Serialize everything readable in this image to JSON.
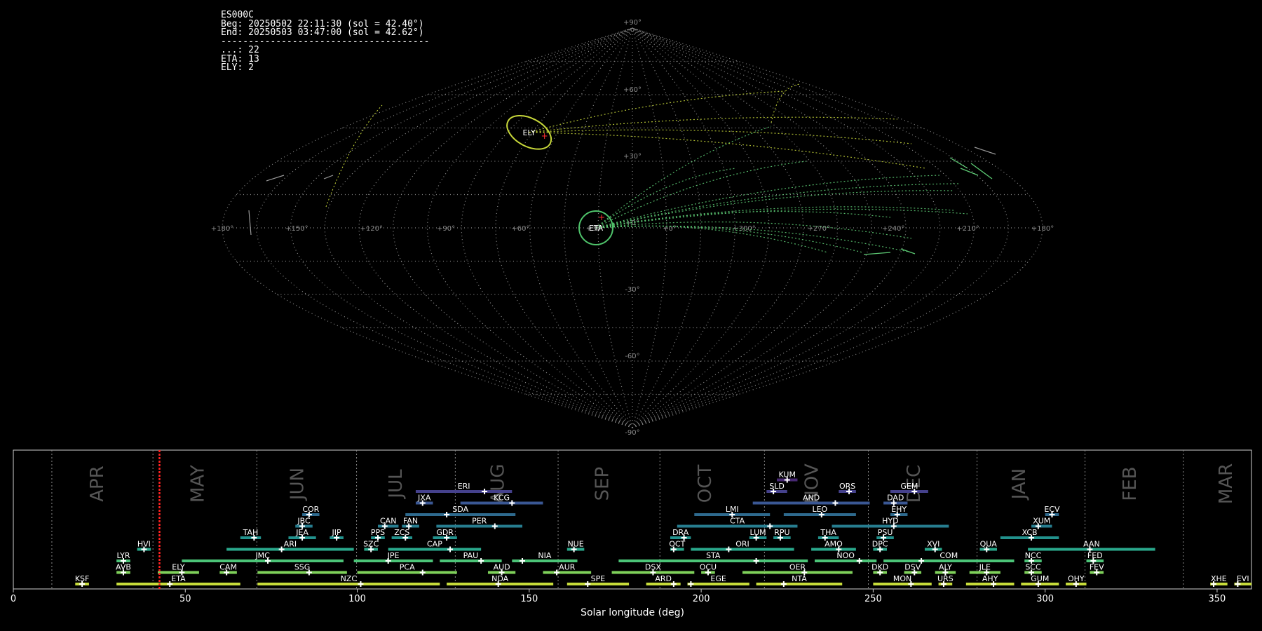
{
  "info": {
    "camera": "ES000C",
    "begin": "Beg: 20250502 22:11:30 (sol = 42.40°)",
    "end": "End: 20250503 03:47:00 (sol = 42.62°)",
    "separator": "--------------------------------------",
    "counts": [
      {
        "label": "...",
        "count": 22
      },
      {
        "label": "ETA",
        "count": 13
      },
      {
        "label": "ELY",
        "count": 2
      }
    ]
  },
  "sky_map": {
    "projection": "sinusoidal",
    "lat_tick_labels": [
      "+90°",
      "+60°",
      "+30°",
      "+0°",
      "-30°",
      "-60°",
      "-90°"
    ],
    "lon_tick_labels": [
      "+180°",
      "+150°",
      "+120°",
      "+90°",
      "+60°",
      "+30°",
      "+0°",
      "+300°",
      "+270°",
      "+240°",
      "+210°",
      "+180°"
    ],
    "radiants": [
      {
        "code": "ETA",
        "lon_offset": -16,
        "lat": 0,
        "color": "#4fc46b"
      },
      {
        "code": "ELY",
        "lon_offset": -62,
        "lat": 43,
        "color": "#c8d83a"
      }
    ]
  },
  "chart_data": {
    "type": "timeline",
    "xlabel": "Solar longitude (deg)",
    "xlim": [
      0,
      360
    ],
    "xticks": [
      0,
      50,
      100,
      150,
      200,
      250,
      300,
      350
    ],
    "current_sol": 42.5,
    "months": [
      {
        "name": "APR",
        "start": 11.2,
        "mid": 24.6
      },
      {
        "name": "MAY",
        "start": 40.6,
        "mid": 53.8
      },
      {
        "name": "JUN",
        "start": 70.8,
        "mid": 82.8
      },
      {
        "name": "JUL",
        "start": 99.8,
        "mid": 111.4
      },
      {
        "name": "AUG",
        "start": 128.5,
        "mid": 141.1
      },
      {
        "name": "SEP",
        "start": 158.4,
        "mid": 171.4
      },
      {
        "name": "OCT",
        "start": 188.0,
        "mid": 201.3
      },
      {
        "name": "NOV",
        "start": 218.4,
        "mid": 232.4
      },
      {
        "name": "DEC",
        "start": 248.6,
        "mid": 262.1
      },
      {
        "name": "JAN",
        "start": 280.2,
        "mid": 292.6
      },
      {
        "name": "FEB",
        "start": 311.6,
        "mid": 324.8
      },
      {
        "name": "MAR",
        "start": 340.2,
        "mid": 352.8
      }
    ],
    "showers": [
      {
        "code": "KSF",
        "start": 18,
        "end": 22,
        "peak": 20,
        "row": 0
      },
      {
        "code": "ETA",
        "start": 30,
        "end": 66,
        "peak": 45.5,
        "row": 0
      },
      {
        "code": "NZC",
        "start": 71,
        "end": 124,
        "peak": 101,
        "row": 0
      },
      {
        "code": "NDA",
        "start": 126,
        "end": 157,
        "peak": 141,
        "row": 0
      },
      {
        "code": "SPE",
        "start": 161,
        "end": 179,
        "peak": 167,
        "row": 0
      },
      {
        "code": "ARD",
        "start": 184,
        "end": 194,
        "peak": 192,
        "row": 0
      },
      {
        "code": "EGE",
        "start": 196,
        "end": 214,
        "peak": 197,
        "row": 0
      },
      {
        "code": "NTA",
        "start": 216,
        "end": 241,
        "peak": 224,
        "row": 0
      },
      {
        "code": "MON",
        "start": 250,
        "end": 267,
        "peak": 261,
        "row": 0
      },
      {
        "code": "URS",
        "start": 269,
        "end": 273,
        "peak": 270.5,
        "row": 0
      },
      {
        "code": "AHY",
        "start": 277,
        "end": 291,
        "peak": 285,
        "row": 0
      },
      {
        "code": "GUM",
        "start": 293,
        "end": 304,
        "peak": 298,
        "row": 0
      },
      {
        "code": "OHY",
        "start": 306,
        "end": 312,
        "peak": 309,
        "row": 0
      },
      {
        "code": "XHE",
        "start": 348,
        "end": 353,
        "peak": 349,
        "row": 0
      },
      {
        "code": "EVI",
        "start": 355,
        "end": 360,
        "peak": 356,
        "row": 0
      },
      {
        "code": "AVB",
        "start": 30,
        "end": 34,
        "peak": 32,
        "row": 1
      },
      {
        "code": "ELY",
        "start": 42,
        "end": 54,
        "peak": 49,
        "row": 1
      },
      {
        "code": "CAM",
        "start": 60,
        "end": 65,
        "peak": 62,
        "row": 1
      },
      {
        "code": "SSG",
        "start": 71,
        "end": 97,
        "peak": 86,
        "row": 1
      },
      {
        "code": "PCA",
        "start": 100,
        "end": 129,
        "peak": 119,
        "row": 1
      },
      {
        "code": "AUD",
        "start": 138,
        "end": 146,
        "peak": 142,
        "row": 1
      },
      {
        "code": "AUR",
        "start": 154,
        "end": 168,
        "peak": 158,
        "row": 1
      },
      {
        "code": "DSX",
        "start": 174,
        "end": 198,
        "peak": 186,
        "row": 1
      },
      {
        "code": "OCU",
        "start": 200,
        "end": 204,
        "peak": 202,
        "row": 1
      },
      {
        "code": "OER",
        "start": 212,
        "end": 244,
        "peak": 230,
        "row": 1
      },
      {
        "code": "DKD",
        "start": 250,
        "end": 254,
        "peak": 252,
        "row": 1
      },
      {
        "code": "DSV",
        "start": 259,
        "end": 264,
        "peak": 262,
        "row": 1
      },
      {
        "code": "ALY",
        "start": 268,
        "end": 274,
        "peak": 271,
        "row": 1
      },
      {
        "code": "JLE",
        "start": 278,
        "end": 287,
        "peak": 283,
        "row": 1
      },
      {
        "code": "SCC",
        "start": 294,
        "end": 299,
        "peak": 296,
        "row": 1
      },
      {
        "code": "FEV",
        "start": 313,
        "end": 317,
        "peak": 315,
        "row": 1
      },
      {
        "code": "LYR",
        "start": 30,
        "end": 34,
        "peak": 32,
        "row": 2
      },
      {
        "code": "JMC",
        "start": 49,
        "end": 96,
        "peak": 74,
        "row": 2
      },
      {
        "code": "JPE",
        "start": 99,
        "end": 122,
        "peak": 109,
        "row": 2
      },
      {
        "code": "PAU",
        "start": 124,
        "end": 142,
        "peak": 136,
        "row": 2
      },
      {
        "code": "NIA",
        "start": 145,
        "end": 164,
        "peak": 148,
        "row": 2
      },
      {
        "code": "STA",
        "start": 176,
        "end": 231,
        "peak": 216,
        "row": 2
      },
      {
        "code": "NOO",
        "start": 233,
        "end": 251,
        "peak": 246,
        "row": 2
      },
      {
        "code": "COM",
        "start": 253,
        "end": 291,
        "peak": 264,
        "row": 2
      },
      {
        "code": "NCC",
        "start": 294,
        "end": 299,
        "peak": 296,
        "row": 2
      },
      {
        "code": "FED",
        "start": 312,
        "end": 317,
        "peak": 314,
        "row": 2
      },
      {
        "code": "HVI",
        "start": 36,
        "end": 40,
        "peak": 38,
        "row": 3
      },
      {
        "code": "ARI",
        "start": 62,
        "end": 99,
        "peak": 78,
        "row": 3
      },
      {
        "code": "SZC",
        "start": 102,
        "end": 106,
        "peak": 104,
        "row": 3
      },
      {
        "code": "CAP",
        "start": 109,
        "end": 136,
        "peak": 127,
        "row": 3
      },
      {
        "code": "NUE",
        "start": 161,
        "end": 166,
        "peak": 163,
        "row": 3
      },
      {
        "code": "OCT",
        "start": 191,
        "end": 195,
        "peak": 192,
        "row": 3
      },
      {
        "code": "ORI",
        "start": 197,
        "end": 227,
        "peak": 208,
        "row": 3
      },
      {
        "code": "AMO",
        "start": 232,
        "end": 245,
        "peak": 240,
        "row": 3
      },
      {
        "code": "DPC",
        "start": 250,
        "end": 254,
        "peak": 252,
        "row": 3
      },
      {
        "code": "XVI",
        "start": 265,
        "end": 270,
        "peak": 268,
        "row": 3
      },
      {
        "code": "QUA",
        "start": 281,
        "end": 286,
        "peak": 283,
        "row": 3
      },
      {
        "code": "AAN",
        "start": 295,
        "end": 332,
        "peak": 313,
        "row": 3
      },
      {
        "code": "TAH",
        "start": 66,
        "end": 72,
        "peak": 70,
        "row": 4
      },
      {
        "code": "JEA",
        "start": 80,
        "end": 88,
        "peak": 84,
        "row": 4
      },
      {
        "code": "JIP",
        "start": 92,
        "end": 96,
        "peak": 94,
        "row": 4
      },
      {
        "code": "PPS",
        "start": 104,
        "end": 108,
        "peak": 106,
        "row": 4
      },
      {
        "code": "ZCS",
        "start": 110,
        "end": 116,
        "peak": 114,
        "row": 4
      },
      {
        "code": "GDR",
        "start": 122,
        "end": 129,
        "peak": 126,
        "row": 4
      },
      {
        "code": "DRA",
        "start": 191,
        "end": 197,
        "peak": 195,
        "row": 4
      },
      {
        "code": "LUM",
        "start": 214,
        "end": 219,
        "peak": 216,
        "row": 4
      },
      {
        "code": "RPU",
        "start": 221,
        "end": 226,
        "peak": 223,
        "row": 4
      },
      {
        "code": "THA",
        "start": 234,
        "end": 240,
        "peak": 236,
        "row": 4
      },
      {
        "code": "PSU",
        "start": 251,
        "end": 256,
        "peak": 253,
        "row": 4
      },
      {
        "code": "XCB",
        "start": 287,
        "end": 304,
        "peak": 296,
        "row": 4
      },
      {
        "code": "JBC",
        "start": 82,
        "end": 87,
        "peak": 84,
        "row": 5
      },
      {
        "code": "CAN",
        "start": 106,
        "end": 112,
        "peak": 108,
        "row": 5
      },
      {
        "code": "FAN",
        "start": 113,
        "end": 118,
        "peak": 115,
        "row": 5
      },
      {
        "code": "PER",
        "start": 123,
        "end": 148,
        "peak": 140,
        "row": 5
      },
      {
        "code": "CTA",
        "start": 193,
        "end": 228,
        "peak": 220,
        "row": 5
      },
      {
        "code": "HYD",
        "start": 238,
        "end": 272,
        "peak": 256,
        "row": 5
      },
      {
        "code": "XUM",
        "start": 296,
        "end": 302,
        "peak": 298,
        "row": 5
      },
      {
        "code": "COR",
        "start": 84,
        "end": 89,
        "peak": 86,
        "row": 6
      },
      {
        "code": "SDA",
        "start": 114,
        "end": 146,
        "peak": 126,
        "row": 6
      },
      {
        "code": "LMI",
        "start": 198,
        "end": 220,
        "peak": 209,
        "row": 6
      },
      {
        "code": "LEO",
        "start": 224,
        "end": 245,
        "peak": 235,
        "row": 6
      },
      {
        "code": "EHY",
        "start": 255,
        "end": 260,
        "peak": 257,
        "row": 6
      },
      {
        "code": "ECV",
        "start": 300,
        "end": 304,
        "peak": 302,
        "row": 6
      },
      {
        "code": "JXA",
        "start": 117,
        "end": 122,
        "peak": 119,
        "row": 7
      },
      {
        "code": "KCG",
        "start": 130,
        "end": 154,
        "peak": 145,
        "row": 7
      },
      {
        "code": "AND",
        "start": 215,
        "end": 249,
        "peak": 239,
        "row": 7
      },
      {
        "code": "DAD",
        "start": 253,
        "end": 260,
        "peak": 256,
        "row": 7
      },
      {
        "code": "ERI",
        "start": 117,
        "end": 145,
        "peak": 137,
        "row": 8
      },
      {
        "code": "SLD",
        "start": 219,
        "end": 225,
        "peak": 221,
        "row": 8
      },
      {
        "code": "ORS",
        "start": 240,
        "end": 245,
        "peak": 243,
        "row": 8
      },
      {
        "code": "GEM",
        "start": 255,
        "end": 266,
        "peak": 262,
        "row": 8
      },
      {
        "code": "KUM",
        "start": 222,
        "end": 228,
        "peak": 225,
        "row": 9
      }
    ]
  }
}
